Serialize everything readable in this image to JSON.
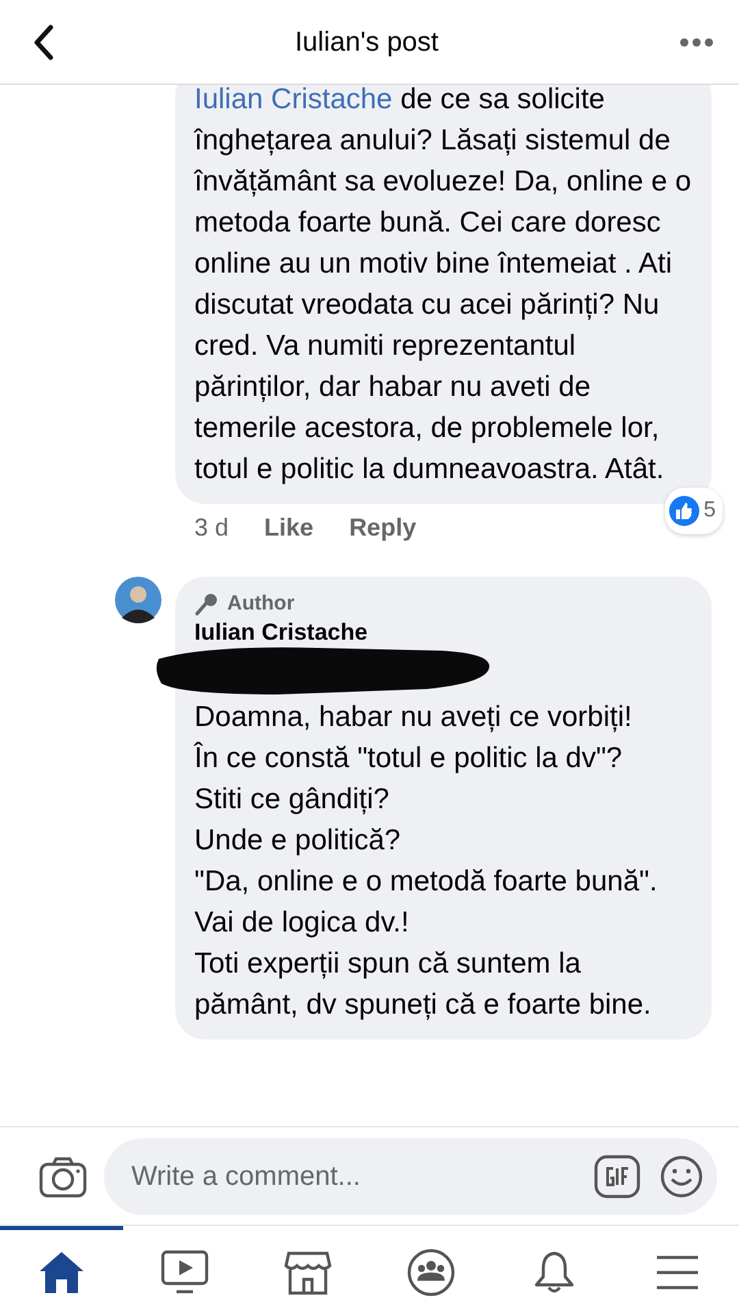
{
  "header": {
    "title": "Iulian's post"
  },
  "comments": [
    {
      "mention": "Iulian Cristache",
      "text": "de ce sa solicite înghețarea anului? Lăsați sistemul de învățământ sa evolueze! Da, online e o metoda foarte bună. Cei care doresc online au un motiv bine întemeiat . Ati discutat vreodata cu acei părinți? Nu cred. Va numiti reprezentantul părinților, dar habar nu aveti de temerile acestora, de problemele lor,  totul e politic la dumneavoastra.  Atât.",
      "time": "3 d",
      "actions": [
        "Like",
        "Reply"
      ],
      "reaction_count": "5"
    },
    {
      "badge": "Author",
      "author": "Iulian Cristache",
      "redacted": true,
      "text": "Doamna, habar nu aveți ce vorbiți!\nÎn ce constă \"totul e politic la dv\"?\nStiti ce gândiți?\nUnde e politică?\n\"Da, online e o metodă foarte bună\".\nVai de logica dv.!\nToti experții spun că suntem la pământ, dv spuneți că e foarte bine."
    }
  ],
  "composer": {
    "placeholder": "Write a comment..."
  },
  "tabs": [
    {
      "kind": "home",
      "selected": true
    },
    {
      "kind": "video",
      "selected": false
    },
    {
      "kind": "marketplace",
      "selected": false
    },
    {
      "kind": "groups",
      "selected": false
    },
    {
      "kind": "notifications",
      "selected": false
    },
    {
      "kind": "menu",
      "selected": false
    }
  ]
}
